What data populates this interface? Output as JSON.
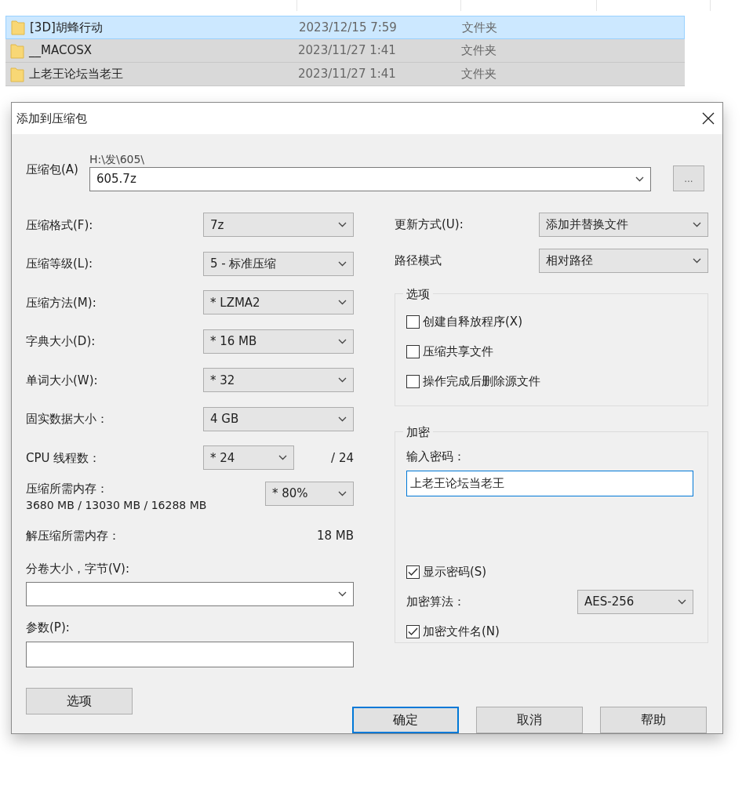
{
  "file_list": {
    "rows": [
      {
        "name": "[3D]胡蜂行动",
        "date": "2023/12/15 7:59",
        "type": "文件夹",
        "selected": true
      },
      {
        "name": "__MACOSX",
        "date": "2023/11/27 1:41",
        "type": "文件夹",
        "selected": false
      },
      {
        "name": "上老王论坛当老王",
        "date": "2023/11/27 1:41",
        "type": "文件夹",
        "selected": false
      }
    ]
  },
  "dialog": {
    "title": "添加到压缩包",
    "archive": {
      "label": "压缩包(A)",
      "path": "H:\\发\\605\\",
      "value": "605.7z",
      "browse": "..."
    },
    "left_rows": [
      {
        "kind": "select",
        "label": "压缩格式(F):",
        "value": "7z"
      },
      {
        "kind": "select",
        "label": "压缩等级(L):",
        "value": "5 - 标准压缩"
      },
      {
        "kind": "select",
        "label": "压缩方法(M):",
        "value": "* LZMA2"
      },
      {
        "kind": "select",
        "label": "字典大小(D):",
        "value": "* 16 MB"
      },
      {
        "kind": "select",
        "label": "单词大小(W):",
        "value": "* 32"
      },
      {
        "kind": "select",
        "label": "固实数据大小：",
        "value": "4 GB"
      },
      {
        "kind": "threads",
        "label": "CPU 线程数：",
        "value": "* 24",
        "total": "/ 24"
      },
      {
        "kind": "memory",
        "label": "压缩所需内存：",
        "detail": "3680 MB / 13030 MB / 16288 MB",
        "value": "* 80%"
      },
      {
        "kind": "info",
        "label": "解压缩所需内存：",
        "value": "18 MB"
      }
    ],
    "volume": {
      "label": "分卷大小，字节(V):"
    },
    "params": {
      "label": "参数(P):"
    },
    "options_button": "选项",
    "update_mode": {
      "label": "更新方式(U):",
      "value": "添加并替换文件"
    },
    "path_mode": {
      "label": "路径模式",
      "value": "相对路径"
    },
    "options_group": {
      "title": "选项",
      "checkboxes": [
        {
          "label": "创建自释放程序(X)",
          "checked": false
        },
        {
          "label": "压缩共享文件",
          "checked": false
        },
        {
          "label": "操作完成后删除源文件",
          "checked": false
        }
      ]
    },
    "encryption": {
      "title": "加密",
      "password_label": "输入密码：",
      "password": "上老王论坛当老王",
      "show_password": {
        "label": "显示密码(S)",
        "checked": true
      },
      "method_label": "加密算法：",
      "method": "AES-256",
      "encrypt_names": {
        "label": "加密文件名(N)",
        "checked": true
      }
    },
    "buttons": [
      {
        "label": "确定",
        "default": true
      },
      {
        "label": "取消",
        "default": false
      },
      {
        "label": "帮助",
        "default": false
      }
    ]
  }
}
